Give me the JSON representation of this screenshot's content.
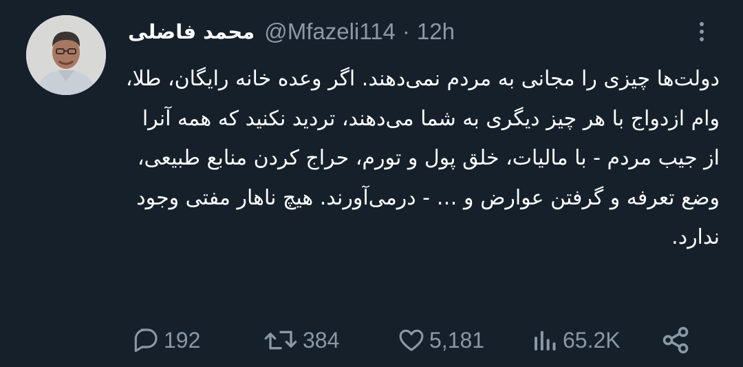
{
  "tweet": {
    "author": {
      "display_name": "محمد فاضلی",
      "handle": "@Mfazeli114",
      "separator": "·",
      "time": "12h"
    },
    "text": "دولت‌ها چیزی را مجانی به مردم نمی‌دهند. اگر وعده خانه رایگان، طلا، وام ازدواج با هر چیز دیگری به شما می‌دهند، تردید نکنید که همه آنرا از جیب مردم - با مالیات، خلق پول و تورم، حراج کردن منابع طبیعی، وضع تعرفه و گرفتن عوارض و … - درمی‌آورند. هیچ ناهار مفتی وجود ندارد.",
    "actions": {
      "replies": "192",
      "reposts": "384",
      "likes": "5,181",
      "views": "65.2K"
    }
  },
  "icons": {
    "avatar": "avatar-photo",
    "more": "more-vertical-icon",
    "reply": "reply-icon",
    "repost": "repost-icon",
    "like": "heart-icon",
    "views": "views-bar-icon",
    "share": "share-icon"
  },
  "colors": {
    "background": "#15202b",
    "text": "#ffffff",
    "secondary": "#8b98a5"
  }
}
